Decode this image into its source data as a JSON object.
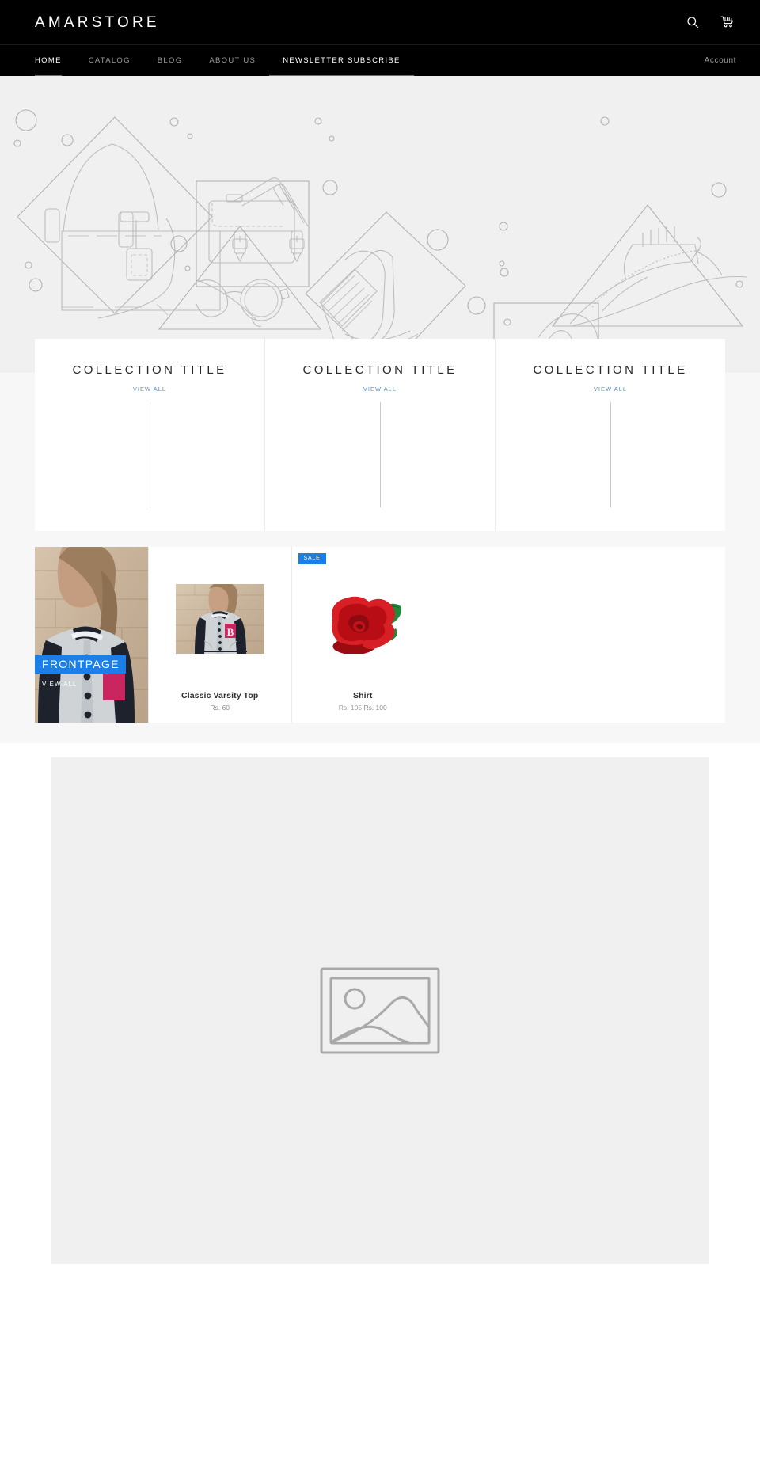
{
  "header": {
    "brand": "AMARSTORE",
    "search_icon": "search-icon",
    "cart_icon": "cart-icon"
  },
  "nav": {
    "items": [
      {
        "label": "HOME",
        "active": true,
        "underlined": true
      },
      {
        "label": "CATALOG",
        "active": false,
        "underlined": false
      },
      {
        "label": "BLOG",
        "active": false,
        "underlined": false
      },
      {
        "label": "ABOUT US",
        "active": false,
        "underlined": false
      },
      {
        "label": "NEWSLETTER SUBSCRIBE",
        "active": true,
        "underlined": true
      }
    ],
    "account_label": "Account"
  },
  "hero": {
    "alt": "lineart-accessories-placeholder",
    "background": "#f0f0f0",
    "stroke": "#b0b0b0"
  },
  "collections": {
    "cards": [
      {
        "title": "COLLECTION TITLE",
        "view_all": "VIEW ALL"
      },
      {
        "title": "COLLECTION TITLE",
        "view_all": "VIEW ALL"
      },
      {
        "title": "COLLECTION TITLE",
        "view_all": "VIEW ALL"
      }
    ]
  },
  "featured": {
    "collection": {
      "badge": "FRONTPAGE",
      "view_all": "VIEW ALL"
    },
    "products": [
      {
        "title": "Classic Varsity Top",
        "price": "Rs. 60",
        "price_old": "",
        "on_sale": false,
        "sale_label": "",
        "image": "varsity-jacket-photo"
      },
      {
        "title": "Shirt",
        "price": "Rs. 100",
        "price_old": "Rs. 105",
        "on_sale": true,
        "sale_label": "SALE",
        "image": "red-rose-image"
      }
    ]
  },
  "bottom": {
    "placeholder_icon": "image-placeholder-icon"
  },
  "colors": {
    "accent": "#1c7fe8",
    "header_bg": "#000000",
    "hero_bg": "#f0f0f0",
    "link": "#5a8fc7"
  }
}
